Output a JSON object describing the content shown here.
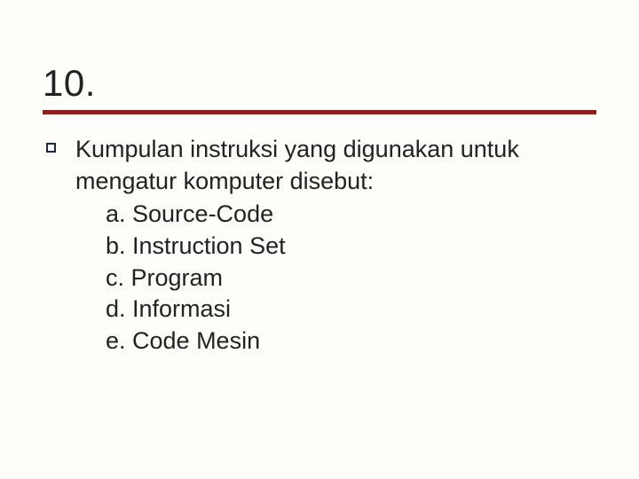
{
  "title": "10.",
  "question": "Kumpulan instruksi yang digunakan untuk mengatur komputer disebut:",
  "options": [
    "a. Source-Code",
    "b. Instruction Set",
    "c. Program",
    "d. Informasi",
    "e. Code Mesin"
  ]
}
